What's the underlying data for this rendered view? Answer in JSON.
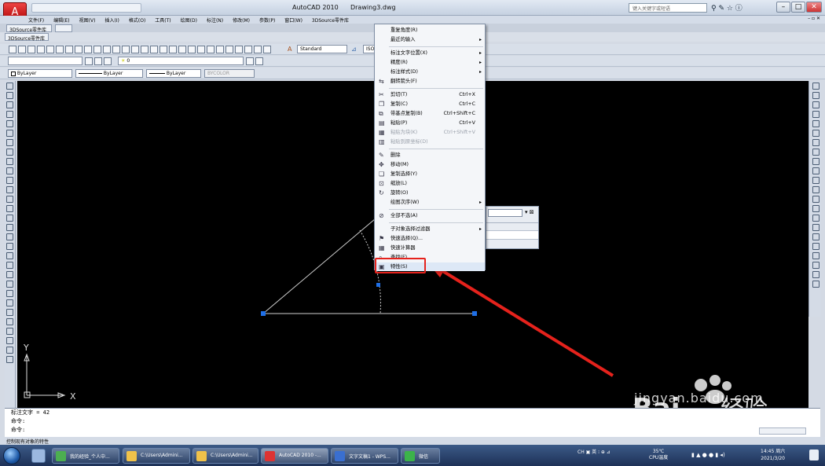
{
  "app": {
    "title": "AutoCAD 2010",
    "filename": "Drawing3.dwg",
    "search_placeholder": "键入关键字或短语"
  },
  "menubar": [
    "文件(F)",
    "编辑(E)",
    "视图(V)",
    "插入(I)",
    "格式(O)",
    "工具(T)",
    "绘图(D)",
    "标注(N)",
    "修改(M)",
    "参数(P)",
    "窗口(W)",
    "3DSource零件库"
  ],
  "tabs": {
    "file_tab": "3DSource零件库",
    "sub_tab": "3DSource零件库"
  },
  "toolbar": {
    "text_style": "Standard",
    "dim_style": "ISO",
    "layer_value": "0",
    "color": "ByLayer",
    "linetype": "ByLayer",
    "lineweight": "ByLayer",
    "plotstyle": "BYCOLOR"
  },
  "context_menu": {
    "items": [
      {
        "label": "重复角度(R)",
        "acc": "",
        "sub": false,
        "disabled": false,
        "icon": ""
      },
      {
        "label": "最近的输入",
        "acc": "",
        "sub": true,
        "disabled": false,
        "icon": ""
      },
      {
        "sep": true
      },
      {
        "label": "标注文字位置(X)",
        "acc": "",
        "sub": true,
        "disabled": false,
        "icon": ""
      },
      {
        "label": "精度(R)",
        "acc": "",
        "sub": true,
        "disabled": false,
        "icon": ""
      },
      {
        "label": "标注样式(D)",
        "acc": "",
        "sub": true,
        "disabled": false,
        "icon": ""
      },
      {
        "label": "翻转箭头(F)",
        "acc": "",
        "sub": false,
        "disabled": false,
        "icon": "flip"
      },
      {
        "sep": true
      },
      {
        "label": "剪切(T)",
        "acc": "Ctrl+X",
        "sub": false,
        "disabled": false,
        "icon": "cut"
      },
      {
        "label": "复制(C)",
        "acc": "Ctrl+C",
        "sub": false,
        "disabled": false,
        "icon": "copy"
      },
      {
        "label": "带基点复制(B)",
        "acc": "Ctrl+Shift+C",
        "sub": false,
        "disabled": false,
        "icon": "copybase"
      },
      {
        "label": "粘贴(P)",
        "acc": "Ctrl+V",
        "sub": false,
        "disabled": false,
        "icon": "paste"
      },
      {
        "label": "粘贴为块(K)",
        "acc": "Ctrl+Shift+V",
        "sub": false,
        "disabled": true,
        "icon": "pasteblock"
      },
      {
        "label": "粘贴到原坐标(D)",
        "acc": "",
        "sub": false,
        "disabled": true,
        "icon": "pasteorig"
      },
      {
        "sep": true
      },
      {
        "label": "删除",
        "acc": "",
        "sub": false,
        "disabled": false,
        "icon": "erase"
      },
      {
        "label": "移动(M)",
        "acc": "",
        "sub": false,
        "disabled": false,
        "icon": "move"
      },
      {
        "label": "复制选择(Y)",
        "acc": "",
        "sub": false,
        "disabled": false,
        "icon": "copysel"
      },
      {
        "label": "缩放(L)",
        "acc": "",
        "sub": false,
        "disabled": false,
        "icon": "scale"
      },
      {
        "label": "旋转(O)",
        "acc": "",
        "sub": false,
        "disabled": false,
        "icon": "rotate"
      },
      {
        "label": "绘图次序(W)",
        "acc": "",
        "sub": true,
        "disabled": false,
        "icon": ""
      },
      {
        "sep": true
      },
      {
        "label": "全部不选(A)",
        "acc": "",
        "sub": false,
        "disabled": false,
        "icon": "deselect"
      },
      {
        "sep": true
      },
      {
        "label": "子对象选择过滤器",
        "acc": "",
        "sub": true,
        "disabled": false,
        "icon": ""
      },
      {
        "label": "快速选择(Q)...",
        "acc": "",
        "sub": false,
        "disabled": false,
        "icon": "qselect"
      },
      {
        "label": "快速计算器",
        "acc": "",
        "sub": false,
        "disabled": false,
        "icon": "calc"
      },
      {
        "label": "查找(F)...",
        "acc": "",
        "sub": false,
        "disabled": false,
        "icon": "find"
      },
      {
        "label": "特性(S)",
        "acc": "",
        "sub": false,
        "disabled": false,
        "icon": "props",
        "highlight": true
      }
    ]
  },
  "command": {
    "line1": "标注文字 = 42",
    "line2": "命令:",
    "line3": "命令:"
  },
  "status_text": "控制现有对象的特性",
  "taskbar": {
    "tasks": [
      {
        "label": "我的经验_个人中..."
      },
      {
        "label": "C:\\Users\\Admini..."
      },
      {
        "label": "C:\\Users\\Admini..."
      },
      {
        "label": "AutoCAD 2010 -..."
      },
      {
        "label": "文字文稿1 - WPS..."
      },
      {
        "label": "微信"
      }
    ],
    "temp": "35℃",
    "temp_label": "CPU温度",
    "time": "14:45 周六",
    "date": "2021/3/20"
  },
  "watermark": {
    "brand": "Bai",
    "brand2": "经验",
    "url": "jingyan.baidu.com"
  },
  "ucs": {
    "x": "X",
    "y": "Y"
  },
  "colors": {
    "highlight_red": "#e5221c",
    "grip_blue": "#1f6fe6"
  }
}
